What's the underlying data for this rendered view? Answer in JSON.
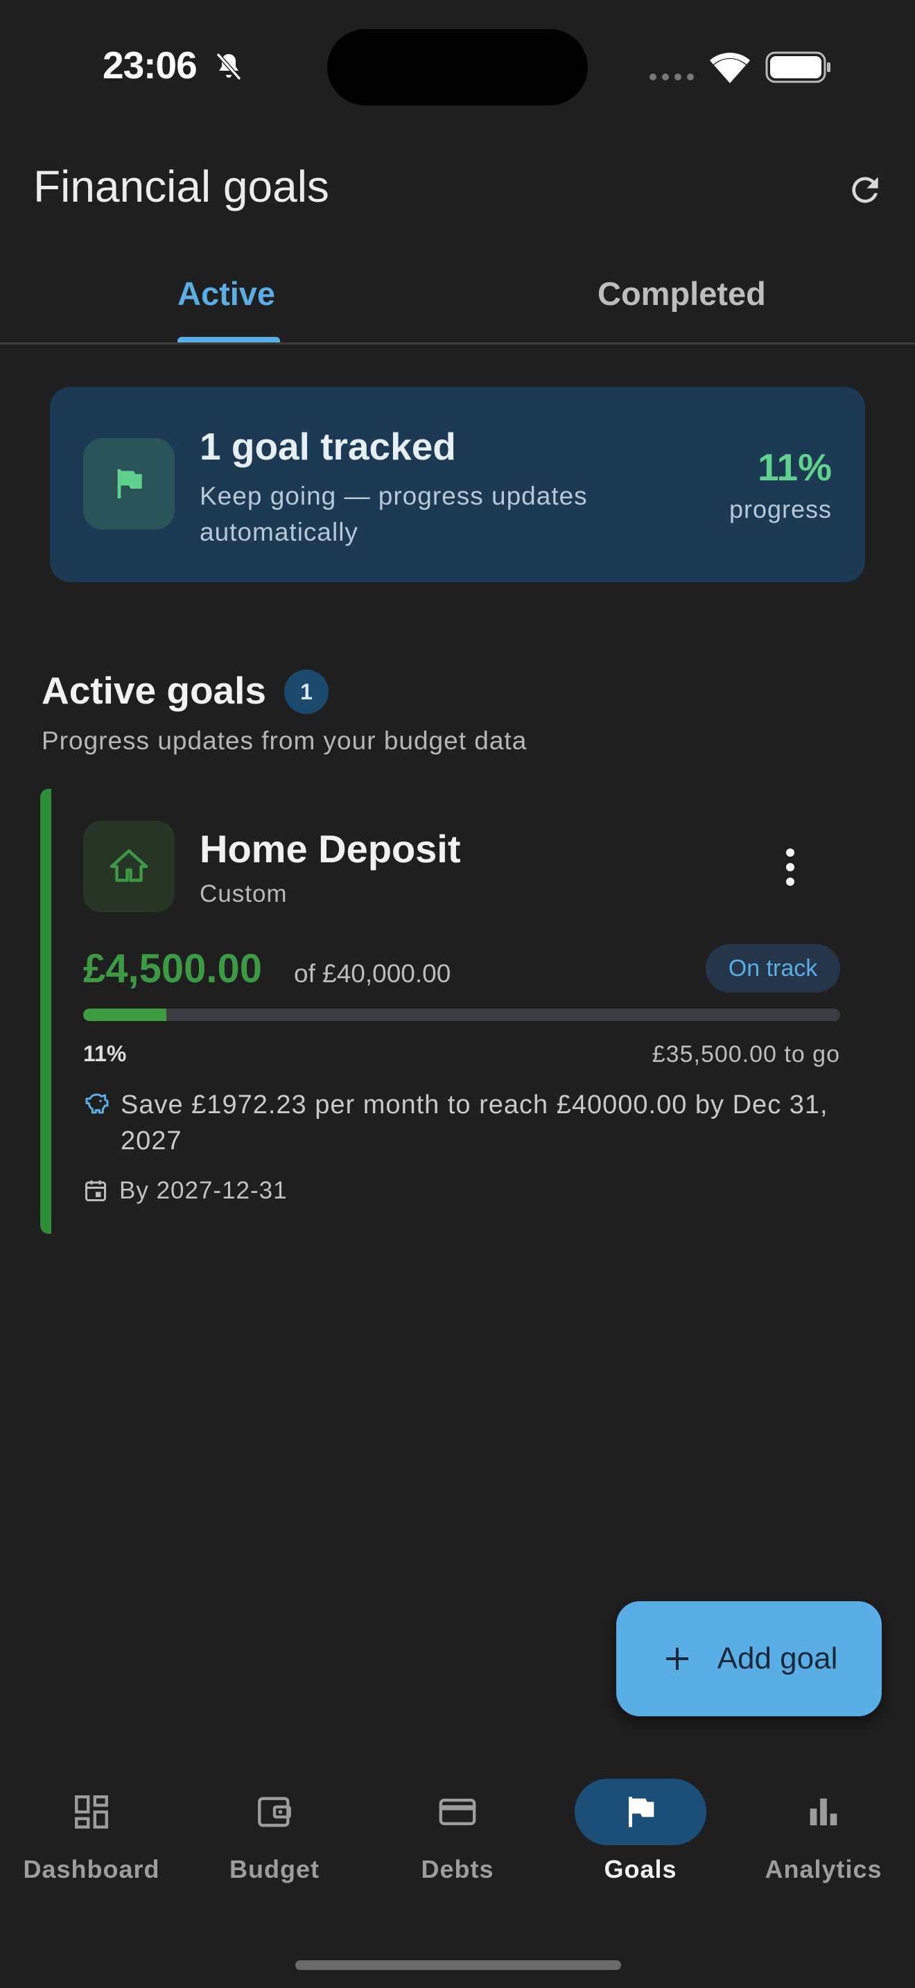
{
  "status_bar": {
    "time": "23:06"
  },
  "header": {
    "title": "Financial goals"
  },
  "tabs": [
    {
      "label": "Active",
      "active": true
    },
    {
      "label": "Completed",
      "active": false
    }
  ],
  "summary": {
    "title": "1 goal tracked",
    "subtitle": "Keep going — progress updates automatically",
    "percent": "11%",
    "percent_label": "progress"
  },
  "section": {
    "title": "Active goals",
    "count": "1",
    "subtitle": "Progress updates from your budget data"
  },
  "goal": {
    "name": "Home Deposit",
    "type": "Custom",
    "amount": "£4,500.00",
    "target": "of £40,000.00",
    "status": "On track",
    "progress_fraction": 0.11,
    "percent_text": "11%",
    "to_go": "£35,500.00 to go",
    "save_message": "Save £1972.23 per month to reach £40000.00 by Dec 31, 2027",
    "deadline": "By 2027-12-31"
  },
  "fab": {
    "label": "Add goal"
  },
  "nav": {
    "dashboard": "Dashboard",
    "budget": "Budget",
    "debts": "Debts",
    "goals": "Goals",
    "analytics": "Analytics",
    "active_item": "Goals"
  },
  "colors": {
    "background": "#1f1f1f",
    "accent": "#5aaee6",
    "goal_green": "#3d9a44",
    "summary_card": "#1c3a54"
  }
}
